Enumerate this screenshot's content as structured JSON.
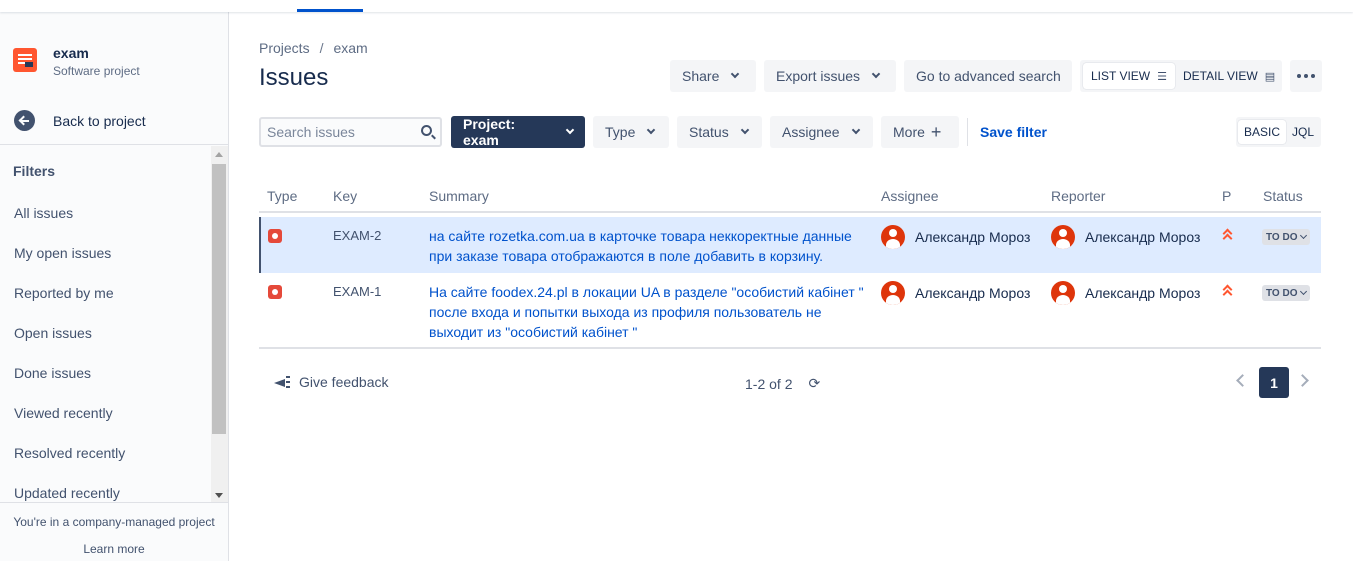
{
  "sidebar": {
    "project_name": "exam",
    "project_type": "Software project",
    "back_label": "Back to project",
    "filters_title": "Filters",
    "filters": [
      "All issues",
      "My open issues",
      "Reported by me",
      "Open issues",
      "Done issues",
      "Viewed recently",
      "Resolved recently",
      "Updated recently"
    ],
    "footer_note": "You're in a company-managed project",
    "learn_more": "Learn more"
  },
  "breadcrumb": [
    "Projects",
    "exam"
  ],
  "breadcrumb_sep": "/",
  "page_title": "Issues",
  "toolbar": {
    "share": "Share",
    "export": "Export issues",
    "advanced": "Go to advanced search",
    "list_view": "LIST VIEW",
    "detail_view": "DETAIL VIEW"
  },
  "filterbar": {
    "search_placeholder": "Search issues",
    "project": "Project: exam",
    "type": "Type",
    "status": "Status",
    "assignee": "Assignee",
    "more": "More",
    "save_filter": "Save filter",
    "basic": "BASIC",
    "jql": "JQL"
  },
  "table": {
    "headers": {
      "type": "Type",
      "key": "Key",
      "summary": "Summary",
      "assignee": "Assignee",
      "reporter": "Reporter",
      "priority": "P",
      "status": "Status"
    },
    "rows": [
      {
        "type": "bug-icon",
        "key": "EXAM-2",
        "summary": "на сайте rozetka.com.ua в карточке товара неккоректные данные при заказе товара отображаются в поле добавить в корзину.",
        "assignee": "Александр Мороз",
        "reporter": "Александр Мороз",
        "priority": "highest",
        "status": "TO DO"
      },
      {
        "type": "bug-icon",
        "key": "EXAM-1",
        "summary": "На сайте foodex.24.pl в локации UA в разделе \"особистий кабінет \" после входа и попытки выхода из профиля пользователь не выходит из \"особистий кабінет \"",
        "assignee": "Александр Мороз",
        "reporter": "Александр Мороз",
        "priority": "highest",
        "status": "TO DO"
      }
    ]
  },
  "footer": {
    "feedback": "Give feedback",
    "count": "1-2 of 2",
    "current_page": "1"
  },
  "colors": {
    "brand": "#0052cc",
    "dark_button": "#253858",
    "selected_row": "#deebff",
    "bug": "#e5493a",
    "priority": "#ff5630"
  }
}
